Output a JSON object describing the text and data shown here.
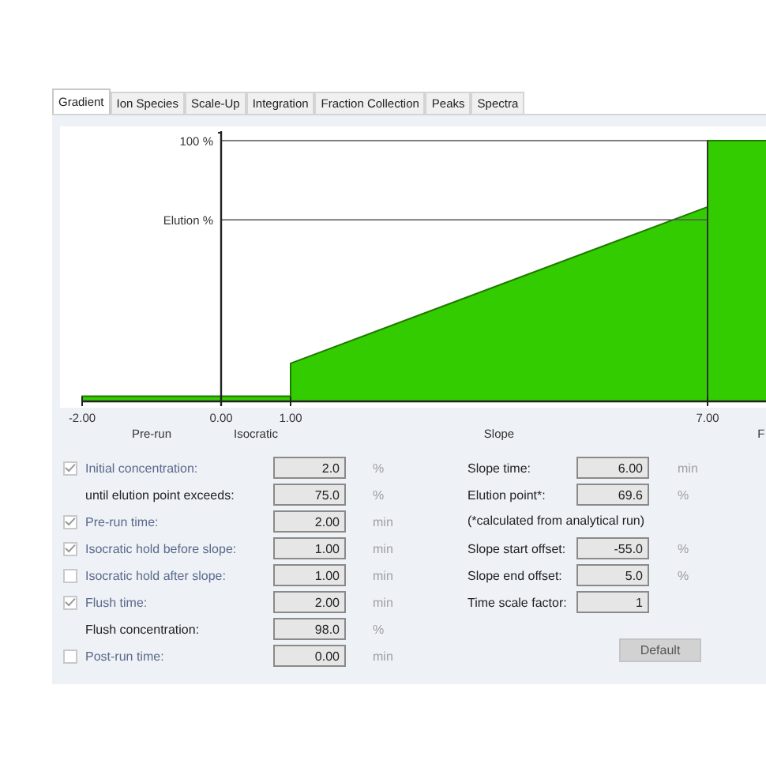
{
  "tabs": [
    {
      "label": "Gradient",
      "selected": true
    },
    {
      "label": "Ion Species",
      "selected": false
    },
    {
      "label": "Scale-Up",
      "selected": false
    },
    {
      "label": "Integration",
      "selected": false
    },
    {
      "label": "Fraction Collection",
      "selected": false
    },
    {
      "label": "Peaks",
      "selected": false
    },
    {
      "label": "Spectra",
      "selected": false
    }
  ],
  "gradient_chart": {
    "y_labels": [
      "100 %",
      "Elution %"
    ],
    "x_labels": [
      "-2.00",
      "0.00",
      "1.00",
      "7.00"
    ],
    "phases": [
      "Pre-run",
      "Isocratic",
      "Slope",
      "F"
    ]
  },
  "left_fields": [
    {
      "kind": "checkbox",
      "label": "Initial concentration:",
      "checked": true,
      "value": "2.0",
      "unit": "%"
    },
    {
      "kind": "plain",
      "label": "until elution point exceeds:",
      "value": "75.0",
      "unit": "%"
    },
    {
      "kind": "checkbox",
      "label": "Pre-run time:",
      "checked": true,
      "value": "2.00",
      "unit": "min"
    },
    {
      "kind": "checkbox",
      "label": "Isocratic hold before slope:",
      "checked": true,
      "value": "1.00",
      "unit": "min"
    },
    {
      "kind": "checkbox",
      "label": "Isocratic hold after slope:",
      "checked": false,
      "value": "1.00",
      "unit": "min"
    },
    {
      "kind": "checkbox",
      "label": "Flush time:",
      "checked": true,
      "value": "2.00",
      "unit": "min"
    },
    {
      "kind": "plain",
      "label": "Flush concentration:",
      "value": "98.0",
      "unit": "%"
    },
    {
      "kind": "checkbox",
      "label": "Post-run time:",
      "checked": false,
      "value": "0.00",
      "unit": "min"
    }
  ],
  "right_fields": [
    {
      "kind": "field",
      "label": "Slope time:",
      "value": "6.00",
      "unit": "min"
    },
    {
      "kind": "field",
      "label": "Elution point*:",
      "value": "69.6",
      "unit": "%"
    },
    {
      "kind": "note",
      "label": "(*calculated from analytical run)"
    },
    {
      "kind": "field",
      "label": "Slope start offset:",
      "value": "-55.0",
      "unit": "%"
    },
    {
      "kind": "field",
      "label": "Slope end offset:",
      "value": "5.0",
      "unit": "%"
    },
    {
      "kind": "field",
      "label": "Time scale factor:",
      "value": "1"
    }
  ],
  "default_button": "Default"
}
